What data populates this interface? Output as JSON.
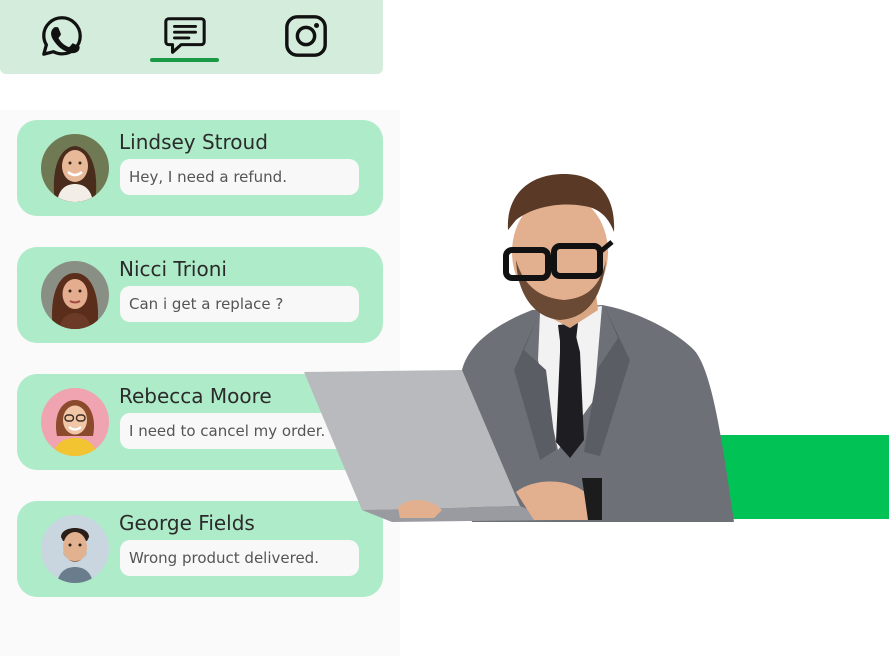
{
  "channels": {
    "tabs": [
      {
        "id": "whatsapp",
        "icon": "whatsapp-icon",
        "active": false
      },
      {
        "id": "chat",
        "icon": "chat-bubble-icon",
        "active": true
      },
      {
        "id": "instagram",
        "icon": "instagram-icon",
        "active": false
      }
    ],
    "active_color": "#1a9a46",
    "bar_color": "#d3ecdb"
  },
  "conversations": [
    {
      "name": "Lindsey Stroud",
      "message": "Hey, I need a refund."
    },
    {
      "name": "Nicci Trioni",
      "message": "Can i get a replace ?"
    },
    {
      "name": "Rebecca Moore",
      "message": "I need to cancel my order."
    },
    {
      "name": "George Fields",
      "message": "Wrong product delivered."
    }
  ],
  "colors": {
    "card": "#aeebc9",
    "accent": "#00c255"
  }
}
